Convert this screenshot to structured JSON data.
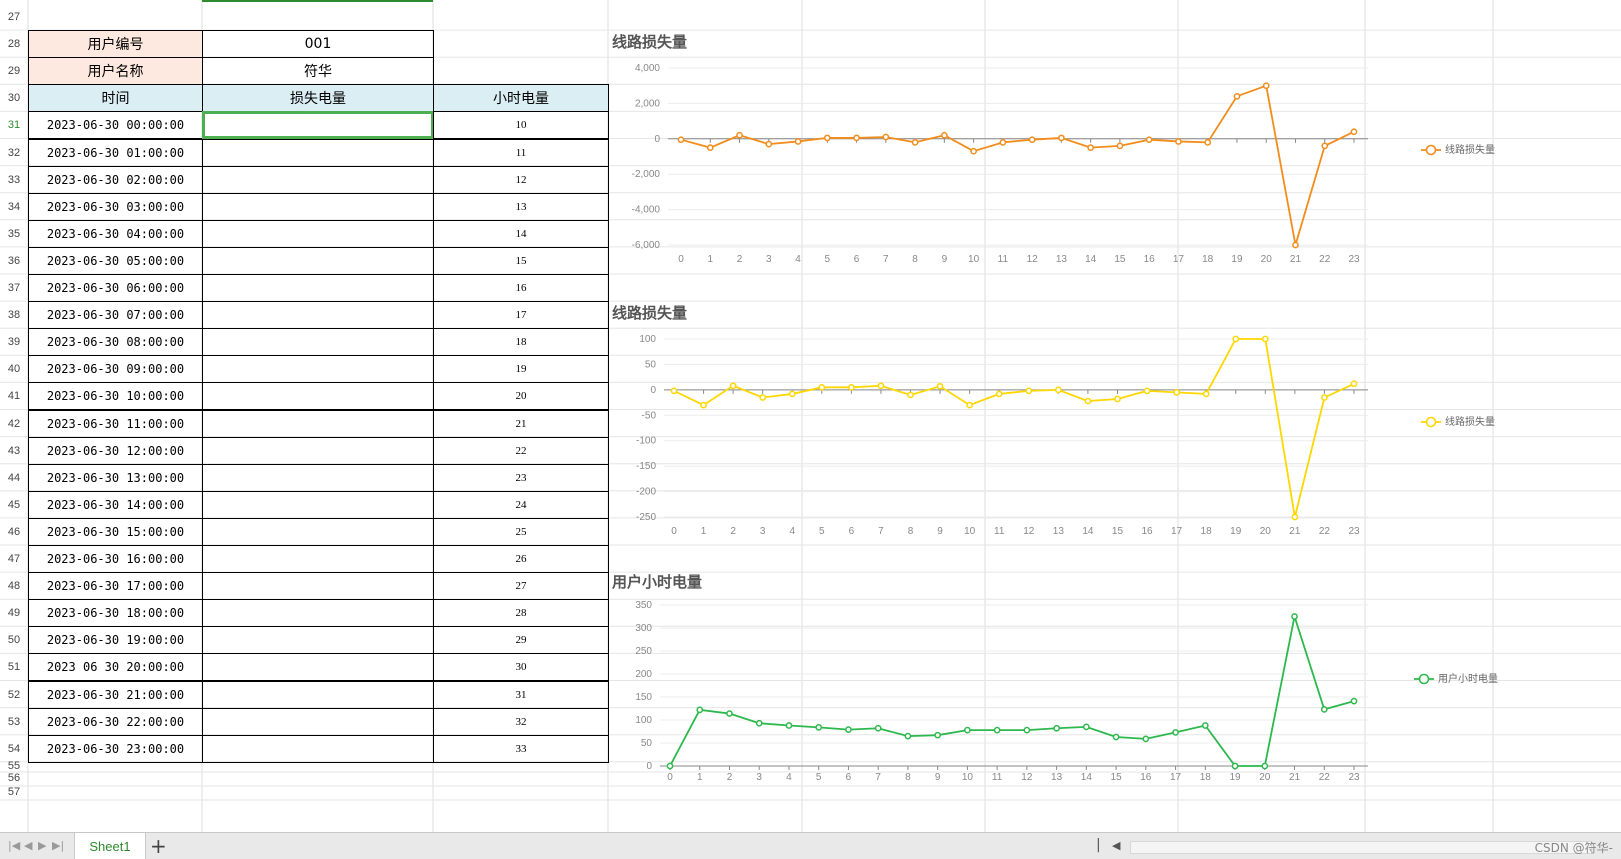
{
  "row_numbers": [
    "27",
    "28",
    "29",
    "30",
    "31",
    "32",
    "33",
    "34",
    "35",
    "36",
    "37",
    "38",
    "39",
    "40",
    "41",
    "42",
    "43",
    "44",
    "45",
    "46",
    "47",
    "48",
    "49",
    "50",
    "51",
    "52",
    "53",
    "54",
    "55",
    "56",
    "57"
  ],
  "header": {
    "user_id_label": "用户编号",
    "user_id_value": "001",
    "user_name_label": "用户名称",
    "user_name_value": "符华",
    "col_time": "时间",
    "col_loss": "损失电量",
    "col_hourly": "小时电量"
  },
  "table_rows": [
    {
      "time": "2023-06-30 00:00:00",
      "hourly": "10"
    },
    {
      "time": "2023-06-30 01:00:00",
      "hourly": "11"
    },
    {
      "time": "2023-06-30 02:00:00",
      "hourly": "12"
    },
    {
      "time": "2023-06-30 03:00:00",
      "hourly": "13"
    },
    {
      "time": "2023-06-30 04:00:00",
      "hourly": "14"
    },
    {
      "time": "2023-06-30 05:00:00",
      "hourly": "15"
    },
    {
      "time": "2023-06-30 06:00:00",
      "hourly": "16"
    },
    {
      "time": "2023-06-30 07:00:00",
      "hourly": "17"
    },
    {
      "time": "2023-06-30 08:00:00",
      "hourly": "18"
    },
    {
      "time": "2023-06-30 09:00:00",
      "hourly": "19"
    },
    {
      "time": "2023-06-30 10:00:00",
      "hourly": "20"
    },
    {
      "time": "2023-06-30 11:00:00",
      "hourly": "21"
    },
    {
      "time": "2023-06-30 12:00:00",
      "hourly": "22"
    },
    {
      "time": "2023-06-30 13:00:00",
      "hourly": "23"
    },
    {
      "time": "2023-06-30 14:00:00",
      "hourly": "24"
    },
    {
      "time": "2023-06-30 15:00:00",
      "hourly": "25"
    },
    {
      "time": "2023-06-30 16:00:00",
      "hourly": "26"
    },
    {
      "time": "2023-06-30 17:00:00",
      "hourly": "27"
    },
    {
      "time": "2023-06-30 18:00:00",
      "hourly": "28"
    },
    {
      "time": "2023-06-30 19:00:00",
      "hourly": "29"
    },
    {
      "time": "2023 06 30 20:00:00",
      "hourly": "30"
    },
    {
      "time": "2023-06-30 21:00:00",
      "hourly": "31"
    },
    {
      "time": "2023-06-30 22:00:00",
      "hourly": "32"
    },
    {
      "time": "2023-06-30 23:00:00",
      "hourly": "33"
    }
  ],
  "sheet_tab": "Sheet1",
  "watermark": "CSDN @符华-",
  "chart_data": [
    {
      "type": "line",
      "title": "线路损失量",
      "color": "#f28c1b",
      "series_name": "线路损失量",
      "x": [
        0,
        1,
        2,
        3,
        4,
        5,
        6,
        7,
        8,
        9,
        10,
        11,
        12,
        13,
        14,
        15,
        16,
        17,
        18,
        19,
        20,
        21,
        22,
        23
      ],
      "values": [
        -50,
        -500,
        200,
        -300,
        -150,
        50,
        50,
        100,
        -200,
        200,
        -700,
        -200,
        -50,
        50,
        -500,
        -400,
        -50,
        -150,
        -200,
        2400,
        3000,
        -6000,
        -400,
        400
      ],
      "ylim": [
        -6000,
        4000
      ],
      "yticks": [
        4000,
        2000,
        0,
        -2000,
        -4000,
        -6000
      ],
      "ytick_labels": [
        "4,000",
        "2,000",
        "0",
        "-2,000",
        "-4,000",
        "-6,000"
      ],
      "legend": "right",
      "grid": true
    },
    {
      "type": "line",
      "title": "线路损失量",
      "color": "#ffd700",
      "series_name": "线路损失量",
      "x": [
        0,
        1,
        2,
        3,
        4,
        5,
        6,
        7,
        8,
        9,
        10,
        11,
        12,
        13,
        14,
        15,
        16,
        17,
        18,
        19,
        20,
        21,
        22,
        23
      ],
      "values": [
        -2,
        -30,
        8,
        -15,
        -8,
        5,
        5,
        8,
        -10,
        7,
        -30,
        -8,
        -2,
        0,
        -22,
        -18,
        -2,
        -5,
        -8,
        100,
        100,
        -250,
        -15,
        12
      ],
      "ylim": [
        -250,
        100
      ],
      "yticks": [
        100,
        50,
        0,
        -50,
        -100,
        -150,
        -200,
        -250
      ],
      "ytick_labels": [
        "100",
        "50",
        "0",
        "-50",
        "-100",
        "-150",
        "-200",
        "-250"
      ],
      "legend": "right",
      "grid": true
    },
    {
      "type": "line",
      "title": "用户小时电量",
      "color": "#2db84d",
      "series_name": "用户小时电量",
      "x": [
        0,
        1,
        2,
        3,
        4,
        5,
        6,
        7,
        8,
        9,
        10,
        11,
        12,
        13,
        14,
        15,
        16,
        17,
        18,
        19,
        20,
        21,
        22,
        23
      ],
      "values": [
        0,
        122,
        114,
        93,
        88,
        84,
        79,
        82,
        65,
        67,
        78,
        78,
        78,
        82,
        85,
        63,
        59,
        73,
        88,
        0,
        0,
        325,
        123,
        141
      ],
      "ylim": [
        0,
        350
      ],
      "yticks": [
        350,
        300,
        250,
        200,
        150,
        100,
        50,
        0
      ],
      "ytick_labels": [
        "350",
        "300",
        "250",
        "200",
        "150",
        "100",
        "50",
        "0"
      ],
      "legend": "right",
      "grid": true
    }
  ]
}
